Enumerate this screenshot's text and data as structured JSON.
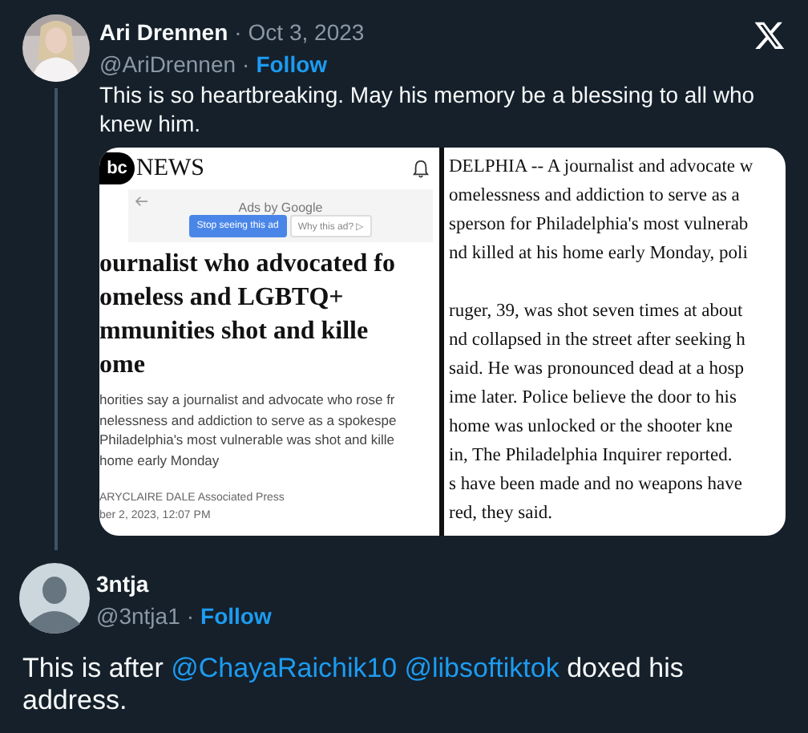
{
  "tweet": {
    "name": "Ari Drennen",
    "separator": "·",
    "date": "Oct 3, 2023",
    "handle": "@AriDrennen",
    "follow": "Follow",
    "text": "This is so heartbreaking. May his memory be a blessing to all who knew him."
  },
  "media": {
    "left": {
      "logo_mark": "bc",
      "logo_word": "NEWS",
      "ads_label": "Ads by Google",
      "ad_buttons": [
        {
          "label": "Stop seeing this ad",
          "kind": "primary"
        },
        {
          "label": "Why this ad? ▷",
          "kind": "secondary"
        }
      ],
      "headline": [
        "ournalist who advocated fo",
        "omeless and LGBTQ+",
        "mmunities shot and kille",
        "ome"
      ],
      "summary": [
        "horities say a journalist and advocate who rose fr",
        "nelessness and addiction to serve as a spokespe",
        "Philadelphia's most vulnerable was shot and kille",
        "home early Monday"
      ],
      "byline": [
        "ARYCLAIRE DALE Associated Press",
        "ber 2, 2023, 12:07 PM"
      ]
    },
    "right": {
      "paragraphs": [
        [
          "DELPHIA -- A journalist and advocate w",
          "omelessness and addiction to serve as a",
          "sperson for Philadelphia's most vulnerab",
          "nd killed at his home early Monday, poli"
        ],
        [
          "ruger, 39, was shot seven times at about",
          "nd collapsed in the street after seeking h",
          "said. He was pronounced dead at a hosp",
          "ime later. Police believe the door to his",
          "home was unlocked or the shooter kne",
          "in, The Philadelphia Inquirer reported.",
          "s have been made and no weapons have",
          "red, they said."
        ]
      ]
    }
  },
  "reply": {
    "name": "3ntja",
    "separator": "·",
    "handle": "@3ntja1",
    "follow": "Follow",
    "avatar": {
      "kind": "default"
    },
    "text": [
      {
        "kind": "plain",
        "text": "This is after "
      },
      {
        "kind": "mention",
        "text": "@ChayaRaichik10"
      },
      {
        "kind": "mention",
        "text": "@libsoftiktok"
      },
      {
        "kind": "plain",
        "text": " doxed his address."
      }
    ]
  }
}
